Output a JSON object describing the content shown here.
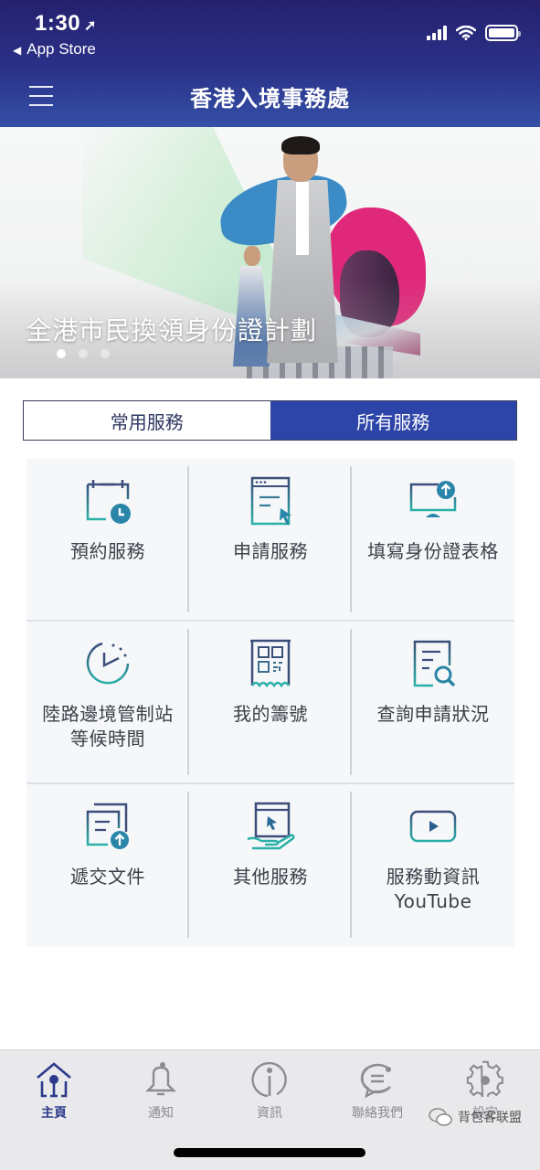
{
  "status_bar": {
    "time": "1:30",
    "location_icon": "location-arrow-icon",
    "back_label": "App Store",
    "signal_icon": "cellular-signal-icon",
    "wifi_icon": "wifi-icon",
    "battery_icon": "battery-icon"
  },
  "header": {
    "menu_icon": "hamburger-menu-icon",
    "title": "香港入境事務處"
  },
  "banner": {
    "title": "全港市民換領身份證計劃",
    "slide_count": 3,
    "active_slide": 1
  },
  "tabs": [
    {
      "label": "常用服務",
      "selected": false
    },
    {
      "label": "所有服務",
      "selected": true
    }
  ],
  "services": [
    {
      "label": "預約服務",
      "icon": "calendar-clock-icon"
    },
    {
      "label": "申請服務",
      "icon": "web-form-cursor-icon"
    },
    {
      "label": "填寫身份證表格",
      "icon": "monitor-upload-icon"
    },
    {
      "label": "陸路邊境管制站\n等候時間",
      "line1": "陸路邊境管制站",
      "line2": "等候時間",
      "icon": "timer-icon"
    },
    {
      "label": "我的籌號",
      "icon": "qr-ticket-icon"
    },
    {
      "label": "查詢申請狀況",
      "icon": "document-search-icon"
    },
    {
      "label": "遞交文件",
      "icon": "document-upload-icon"
    },
    {
      "label": "其他服務",
      "icon": "hand-window-cursor-icon"
    },
    {
      "label": "服務動資訊\nYouTube",
      "line1": "服務動資訊",
      "line2": "YouTube",
      "icon": "youtube-play-icon"
    }
  ],
  "bottom_nav": [
    {
      "label": "主頁",
      "icon": "home-icon",
      "active": true
    },
    {
      "label": "通知",
      "icon": "bell-icon",
      "active": false
    },
    {
      "label": "資訊",
      "icon": "info-icon",
      "active": false
    },
    {
      "label": "聯絡我們",
      "icon": "chat-bubble-icon",
      "active": false
    },
    {
      "label": "設定",
      "icon": "gear-icon",
      "active": false
    }
  ],
  "watermark": {
    "text": "背包客联盟",
    "icon": "wechat-icon"
  },
  "colors": {
    "header_top": "#25206e",
    "header_bottom": "#3450a6",
    "tab_active": "#2d44a8",
    "icon_teal": "#2a8aa6",
    "icon_navy": "#3b4e7a",
    "nav_active": "#2c3a8a"
  }
}
